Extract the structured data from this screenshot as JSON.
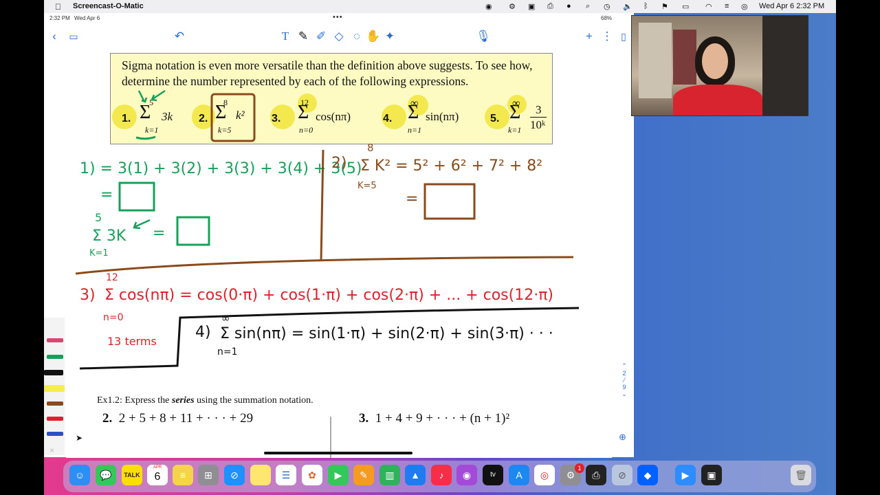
{
  "menubar": {
    "app_name": "Screencast-O-Matic",
    "clock": "Wed Apr 6  2:32 PM",
    "battery": "68%"
  },
  "ipad_status": {
    "time": "2:32 PM",
    "date": "Wed Apr 6",
    "battery": "68%"
  },
  "toolbar": {
    "back_icon": "chevron-left-icon",
    "pages_icon": "pages-icon",
    "undo_icon": "undo-icon",
    "tools": [
      "text-tool-icon",
      "pen-icon",
      "highlighter-icon",
      "eraser-icon",
      "lasso-icon",
      "hand-icon",
      "pointer-icon"
    ],
    "mic_icon": "microphone-icon",
    "add_icon": "plus-icon",
    "more_icon": "more-icon"
  },
  "problem": {
    "intro": "Sigma notation is even more versatile than the definition above suggests. To see how, determine the number represented by each of the following expressions.",
    "expressions": [
      {
        "num": "1.",
        "upper": "5",
        "lower": "k=1",
        "term": "3k"
      },
      {
        "num": "2.",
        "upper": "8",
        "lower": "k=5",
        "term": "k²"
      },
      {
        "num": "3.",
        "upper": "12",
        "lower": "n=0",
        "term": "cos(nπ)"
      },
      {
        "num": "4.",
        "upper": "∞",
        "lower": "n=1",
        "term": "sin(nπ)"
      },
      {
        "num": "5.",
        "upper": "∞",
        "lower": "k=1",
        "term_num": "3",
        "term_den": "10ᵏ"
      }
    ]
  },
  "handwriting": {
    "p1_line": "1) = 3(1) + 3(2) + 3(3) + 3(4) + 3(5)",
    "p1_eq": "=",
    "p1_sum_upper": "5",
    "p1_sum_term": "Σ 3K",
    "p1_sum_lower": "K=1",
    "p1_sum_eq": "=",
    "p2_label": "2)",
    "p2_sum_upper": "8",
    "p2_sum": "Σ K² = 5² + 6² + 7² + 8²",
    "p2_sum_lower": "K=5",
    "p2_eq": "=",
    "p3_label": "3)",
    "p3_sum_upper": "12",
    "p3_line": "Σ cos(nπ) = cos(0·π) + cos(1·π) + cos(2·π) + ... + cos(12·π)",
    "p3_sum_lower": "n=0",
    "p3_terms": "13 terms",
    "p4_label": "4)",
    "p4_line": "Σ sin(nπ) = sin(1·π) + sin(2·π) + sin(3·π) · · ·",
    "p4_sum_upper": "∞",
    "p4_sum_lower": "n=1"
  },
  "exercise": {
    "heading_prefix": "Ex1.2: Express the ",
    "heading_em": "series",
    "heading_suffix": " using the summation notation.",
    "item2_num": "2.",
    "item2": "2 + 5 + 8 + 11 + · · · + 29",
    "item3_num": "3.",
    "item3": "1 + 4 + 9 + · · · + (n + 1)²"
  },
  "page_indicator": {
    "current": "2",
    "total": "9"
  },
  "dock": {
    "apps": [
      "finder",
      "messages",
      "kakaotalk",
      "calendar",
      "notes",
      "launchpad",
      "safari",
      "stickies",
      "reminders",
      "photos",
      "facetime",
      "pages",
      "numbers",
      "keynote",
      "music",
      "podcasts",
      "apple-tv",
      "app-store",
      "chrome",
      "system-preferences",
      "printer",
      "block",
      "dropbox",
      "zoom",
      "screencast",
      "trash"
    ],
    "calendar_month": "APR",
    "calendar_day": "6",
    "badge": "1"
  },
  "colors": {
    "green": "#16a05a",
    "brown": "#8a4b1c",
    "red": "#e0202a",
    "black": "#111111",
    "accent": "#2b6dd6",
    "highlight": "#f3e94e"
  }
}
